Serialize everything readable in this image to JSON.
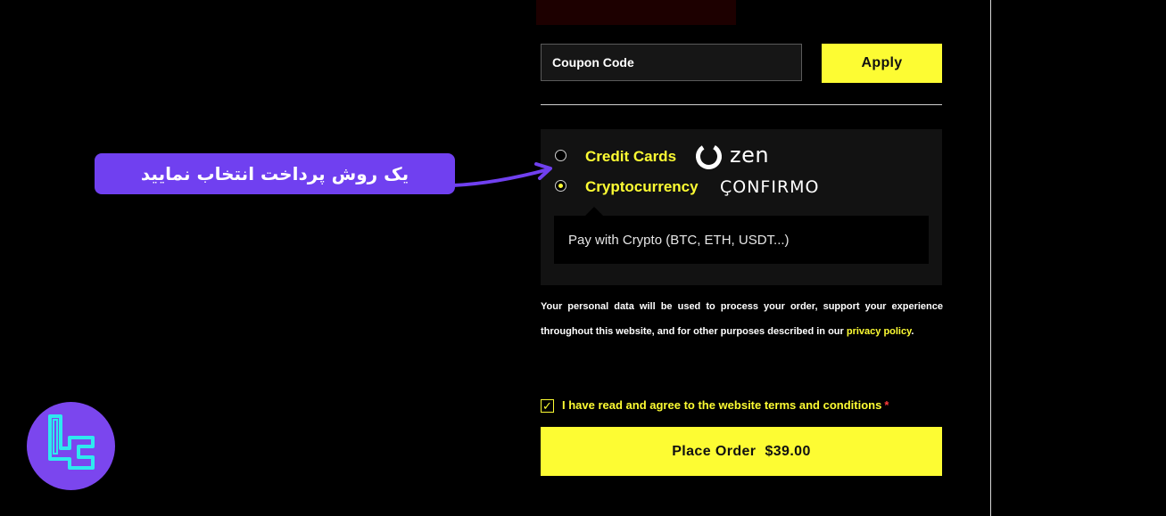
{
  "coupon": {
    "placeholder": "Coupon Code",
    "apply_label": "Apply"
  },
  "payment": {
    "methods": [
      {
        "label": "Credit Cards",
        "brand": "zen",
        "selected": false
      },
      {
        "label": "Cryptocurrency",
        "brand": "ÇONFIRMO",
        "selected": true
      }
    ],
    "crypto_description": "Pay with Crypto (BTC, ETH, USDT...)"
  },
  "callout": {
    "text": "یک روش پرداخت انتخاب نمایید"
  },
  "privacy": {
    "text": "Your personal data will be used to process your order, support your experience throughout this website, and for other purposes described in our",
    "link": "privacy policy",
    "end": "."
  },
  "terms": {
    "label": "I have read and agree to the website terms and conditions",
    "required_mark": "*",
    "checked": true,
    "check_glyph": "✓"
  },
  "order": {
    "label": "Place Order",
    "price": "$39.00"
  },
  "colors": {
    "accent": "#fdfc33",
    "callout": "#7040f0",
    "background": "#000000"
  }
}
